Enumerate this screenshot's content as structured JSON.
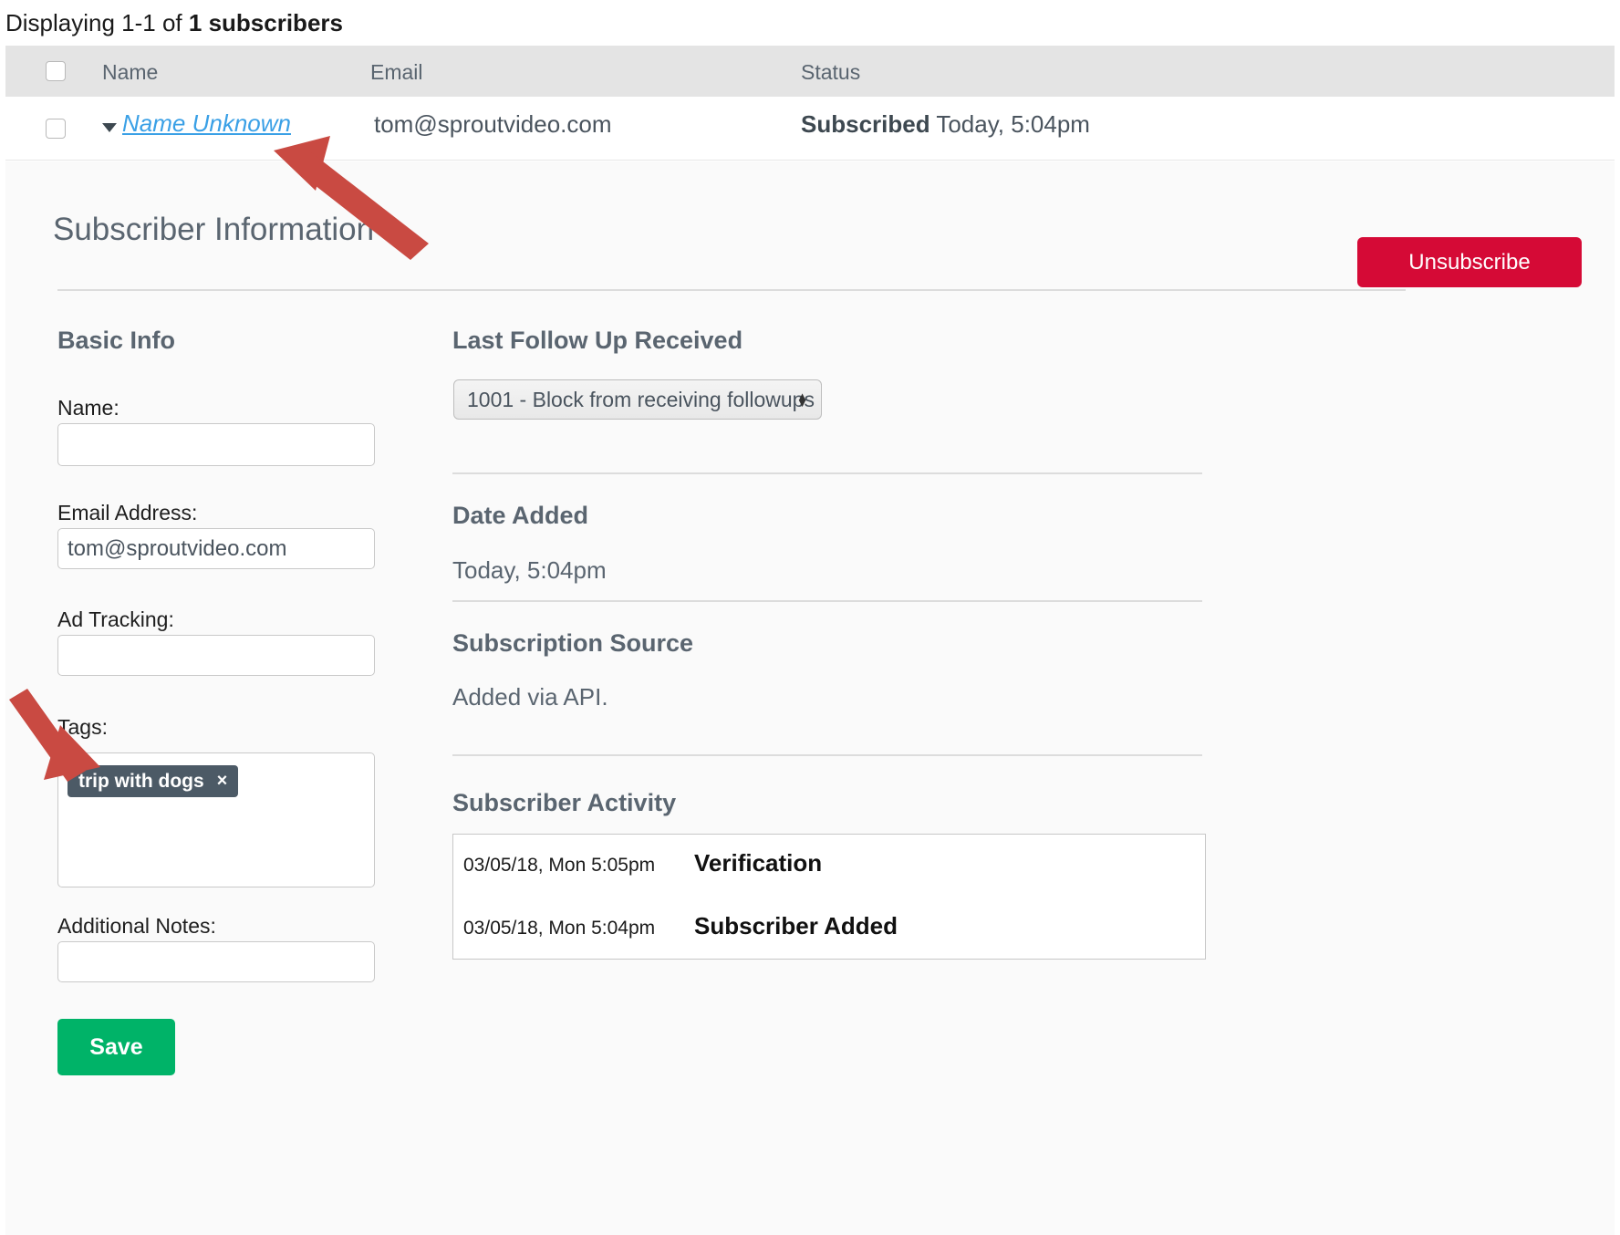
{
  "list": {
    "caption_prefix": "Displaying 1-1 of ",
    "caption_strong": "1 subscribers",
    "columns": {
      "name": "Name",
      "email": "Email",
      "status": "Status"
    },
    "row": {
      "name_link": "Name Unknown",
      "email": "tom@sproutvideo.com",
      "status_strong": "Subscribed",
      "status_time": " Today, 5:04pm"
    }
  },
  "detail": {
    "title": "Subscriber Information",
    "unsubscribe_label": "Unsubscribe",
    "basic_info": {
      "heading": "Basic Info",
      "name_label": "Name:",
      "name_value": "",
      "email_label": "Email Address:",
      "email_value": "tom@sproutvideo.com",
      "ad_tracking_label": "Ad Tracking:",
      "ad_tracking_value": "",
      "tags_label": "Tags:",
      "tags": [
        {
          "label": "trip with dogs",
          "remove_icon": "×"
        }
      ],
      "notes_label": "Additional Notes:",
      "notes_value": "",
      "save_label": "Save"
    },
    "last_follow_up": {
      "heading": "Last Follow Up Received",
      "selected_option": "1001 - Block from receiving followups"
    },
    "date_added": {
      "heading": "Date Added",
      "value": "Today, 5:04pm"
    },
    "subscription_source": {
      "heading": "Subscription Source",
      "value": "Added via API."
    },
    "subscriber_activity": {
      "heading": "Subscriber Activity",
      "rows": [
        {
          "date": "03/05/18, Mon 5:05pm",
          "event": "Verification"
        },
        {
          "date": "03/05/18, Mon 5:04pm",
          "event": "Subscriber Added"
        }
      ]
    }
  },
  "colors": {
    "unsubscribe_red": "#d50a36",
    "save_green": "#00b368",
    "tag_slate": "#4c5a66",
    "link_blue": "#3aa0e6",
    "annotation_red": "#c94a42",
    "header_gray": "#e4e4e4",
    "panel_gray": "#fafafa"
  }
}
